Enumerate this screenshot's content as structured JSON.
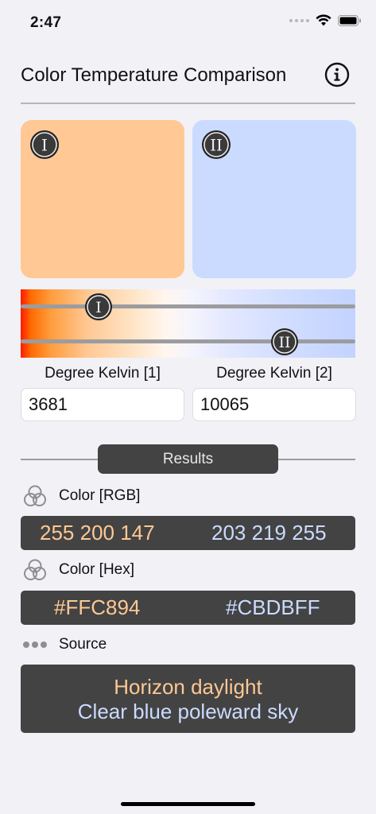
{
  "status_bar": {
    "time": "2:47"
  },
  "header": {
    "title": "Color Temperature Comparison"
  },
  "swatches": [
    {
      "badge": "I",
      "color": "#FFC894"
    },
    {
      "badge": "II",
      "color": "#CBDBFF"
    }
  ],
  "sliders": [
    {
      "badge": "I",
      "value": 3681
    },
    {
      "badge": "II",
      "value": 10065
    }
  ],
  "inputs": {
    "label_1": "Degree Kelvin [1]",
    "label_2": "Degree Kelvin [2]",
    "value_1": "3681",
    "value_2": "10065"
  },
  "results": {
    "button_label": "Results",
    "rgb_label": "Color [RGB]",
    "rgb_1": "255 200 147",
    "rgb_2": "203 219 255",
    "hex_label": "Color [Hex]",
    "hex_1": "#FFC894",
    "hex_2": "#CBDBFF",
    "source_label": "Source",
    "source_1": "Horizon daylight",
    "source_2": "Clear blue poleward sky"
  },
  "colors": {
    "background": "#F2F1F6",
    "panel": "#434343",
    "warm": "#FFC894",
    "cool": "#CBDBFF"
  }
}
